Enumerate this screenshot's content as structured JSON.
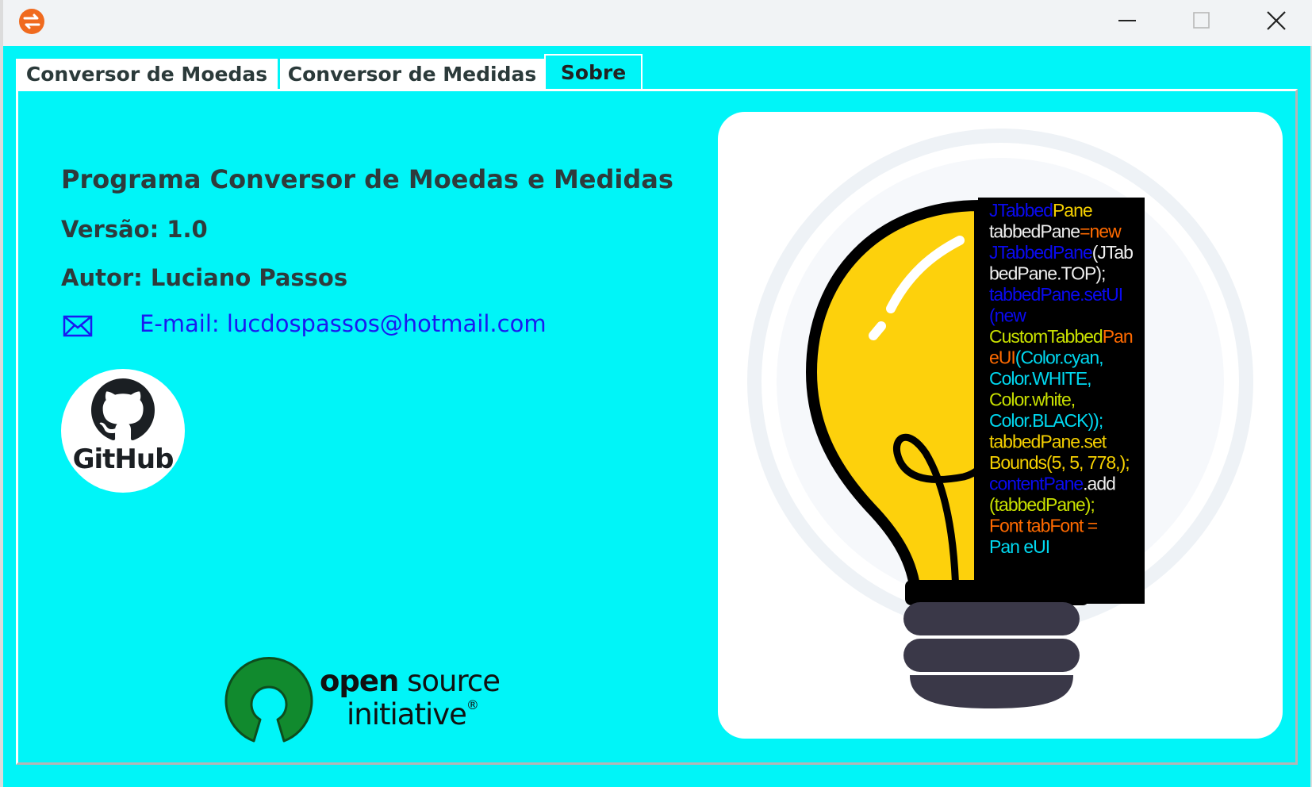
{
  "titlebar": {
    "app_icon": "currency-exchange-icon",
    "controls": [
      "minimize-icon",
      "maximize-icon",
      "close-icon"
    ]
  },
  "tabs": [
    {
      "label": "Conversor de Moedas",
      "selected": false
    },
    {
      "label": "Conversor de Medidas",
      "selected": false
    },
    {
      "label": "Sobre",
      "selected": true
    }
  ],
  "about": {
    "title": "Programa Conversor de Moedas e Medidas",
    "version": "Versão: 1.0",
    "author": "Autor: Luciano  Passos",
    "email": "E-mail: lucdospassos@hotmail.com",
    "github_label": "GitHub",
    "osi_line1_bold": "open",
    "osi_line1_rest": " source",
    "osi_line2": "initiative",
    "osi_reg": "®"
  },
  "bulb_code": [
    [
      [
        "JTabbed",
        "#0a0af0"
      ],
      [
        "Pane",
        "#f5d000"
      ]
    ],
    [
      [
        "tabbedPane",
        "#f0f0f0"
      ],
      [
        "=new",
        "#ff6a00"
      ]
    ],
    [
      [
        "JTabbedPane",
        "#0a0af0"
      ],
      [
        "(JTab",
        "#f0f0f0"
      ]
    ],
    [
      [
        "bedPane.TOP);",
        "#f0f0f0"
      ]
    ],
    [
      [
        "tabbedPane.setUI",
        "#0a0af0"
      ]
    ],
    [
      [
        "(new",
        "#0a0af0"
      ]
    ],
    [
      [
        "CustomTabbed",
        "#c8e000"
      ],
      [
        "Pan",
        "#ff6a00"
      ]
    ],
    [
      [
        "eUI",
        "#ff6a00"
      ],
      [
        "(Color.cyan,",
        "#00d8f0"
      ]
    ],
    [
      [
        "Color.WHITE,",
        "#00d8f0"
      ]
    ],
    [
      [
        "Color.white,",
        "#c8e000"
      ]
    ],
    [
      [
        "Color.BLACK));",
        "#00d8f0"
      ]
    ],
    [
      [
        "tabbedPane.set",
        "#f5d000"
      ]
    ],
    [
      [
        "Bounds(5, 5, 778,);",
        "#f5d000"
      ]
    ],
    [
      [
        "contentPane",
        "#0a0af0"
      ],
      [
        ".add",
        "#f0f0f0"
      ]
    ],
    [
      [
        "(tabbedPane);",
        "#c8e000"
      ]
    ],
    [
      [
        "Font tabFont =",
        "#ff6a00"
      ]
    ],
    [
      [
        "Pan eUI",
        "#00d8f0"
      ]
    ]
  ],
  "colors": {
    "background": "#00f5f8",
    "bulb_yellow": "#fdd10c",
    "bulb_base": "#3a3848",
    "email_link": "#1a1af0",
    "osi_green": "#118a2e"
  }
}
